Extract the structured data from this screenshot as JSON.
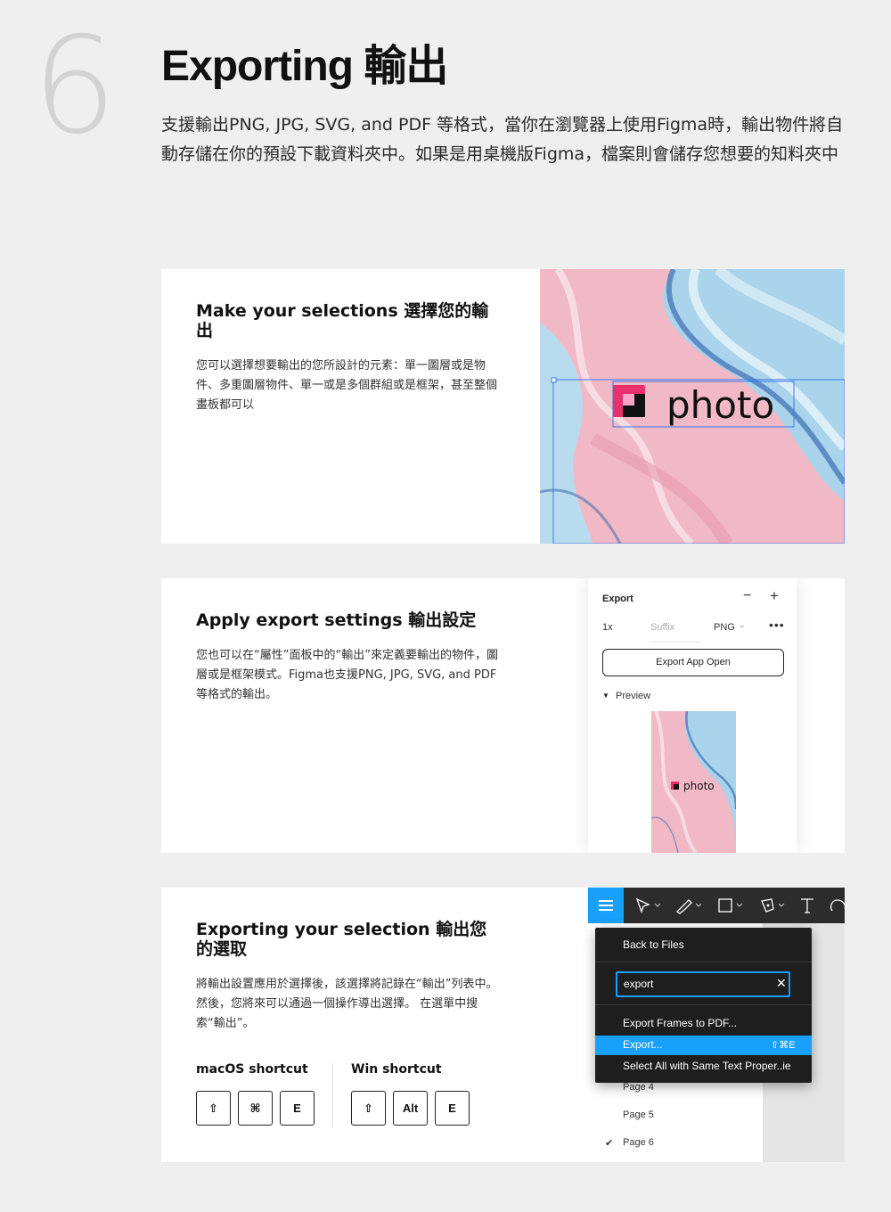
{
  "header": {
    "step_number": "6",
    "title": "Exporting 輸出",
    "intro": "支援輸出PNG, JPG, SVG, and PDF 等格式，當你在瀏覽器上使用Figma時，輸出物件將自動存儲在你的預設下載資料夾中。如果是用桌機版Figma，檔案則會儲存您想要的知料夾中"
  },
  "card1": {
    "title": "Make your selections 選擇您的輸出",
    "body": "您可以選擇想要輸出的您所設計的元素：單一圖層或是物件、多重圖層物件、單一或是多個群組或是框架，甚至整個畫板都可以",
    "image_text": "photo",
    "logo_color": "#e8306c"
  },
  "card2": {
    "title": "Apply export settings 輸出設定",
    "body": "您也可以在“屬性”面板中的“輸出”來定義要輸出的物件，圖層或是框架模式。Figma也支援PNG, JPG, SVG, and PDF 等格式的輸出。",
    "panel": {
      "title": "Export",
      "minus": "−",
      "plus": "+",
      "scale": "1x",
      "suffix_placeholder": "Suffix",
      "format": "PNG",
      "more": "•••",
      "button": "Export App Open",
      "preview_label": "Preview",
      "thumb_text": "photo"
    }
  },
  "card3": {
    "title": "Exporting your selection 輸出您的選取",
    "body": "將輸出設置應用於選擇後，該選擇將記錄在“輸出”列表中。 然後，您將來可以通過一個操作導出選擇。 在選單中搜索“輸出”。",
    "macos": {
      "label": "macOS shortcut",
      "keys": [
        "⇧",
        "⌘",
        "E"
      ]
    },
    "win": {
      "label": "Win shortcut",
      "keys": [
        "⇧",
        "Alt",
        "E"
      ]
    },
    "menu": {
      "back": "Back to Files",
      "search_value": "export",
      "clear": "✕",
      "items": [
        "Export Frames to PDF...",
        "Export...",
        "Select All with Same Text Proper..ie"
      ],
      "export_shortcut": "⇧⌘E"
    },
    "pages": [
      "Page 4",
      "Page 5",
      "Page 6"
    ],
    "page_check": "✔",
    "accent_color": "#18a0fb"
  }
}
